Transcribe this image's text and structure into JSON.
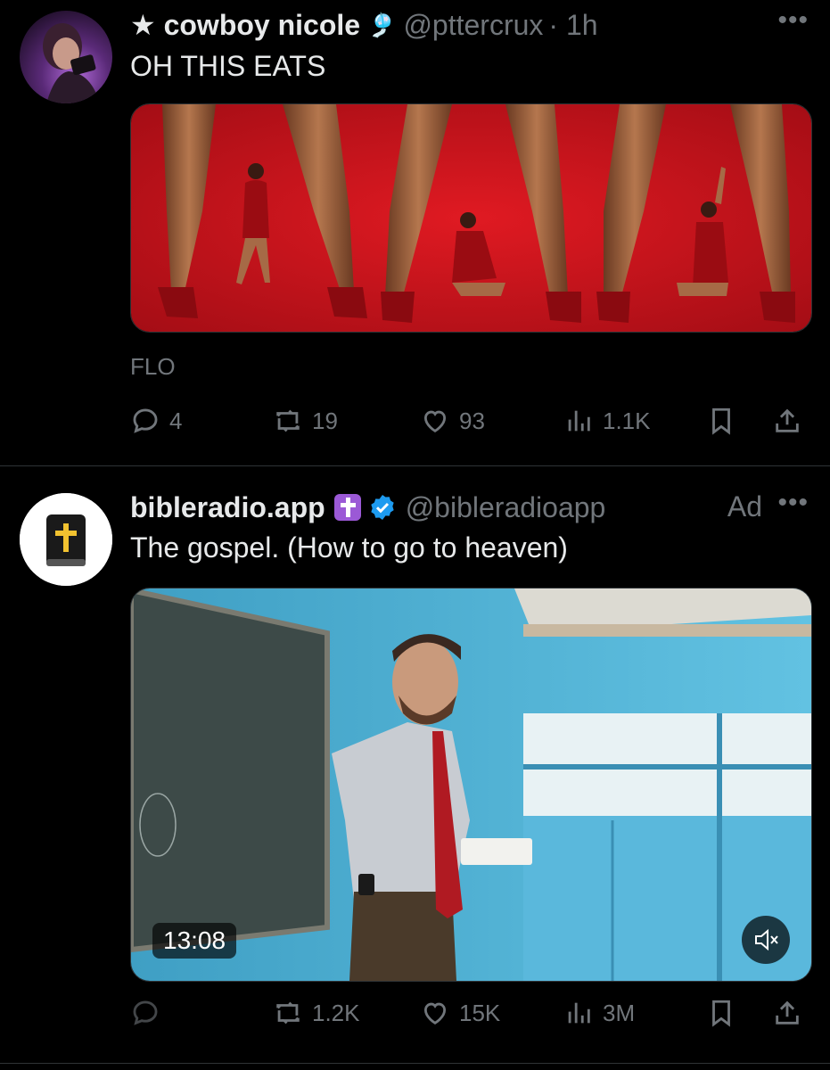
{
  "tweets": [
    {
      "display_name": "★ cowboy nicole",
      "name_emoji": "🎐",
      "handle": "@pttercrux",
      "time": "· 1h",
      "text": "OH THIS EATS",
      "media_caption": "FLO",
      "stats": {
        "replies": "4",
        "reposts": "19",
        "likes": "93",
        "views": "1.1K"
      }
    },
    {
      "display_name": "bibleradio.app",
      "name_emoji": "✝️",
      "verified": true,
      "handle": "@bibleradioapp",
      "ad_label": "Ad",
      "text": "The gospel. (How to go to heaven)",
      "video_duration": "13:08",
      "stats": {
        "replies": "",
        "reposts": "1.2K",
        "likes": "15K",
        "views": "3M"
      }
    }
  ],
  "colors": {
    "background": "#000000",
    "muted": "#71767b",
    "verified": "#1d9bf0",
    "poster_red": "#c8141c",
    "wall_blue": "#4fb3d6"
  }
}
